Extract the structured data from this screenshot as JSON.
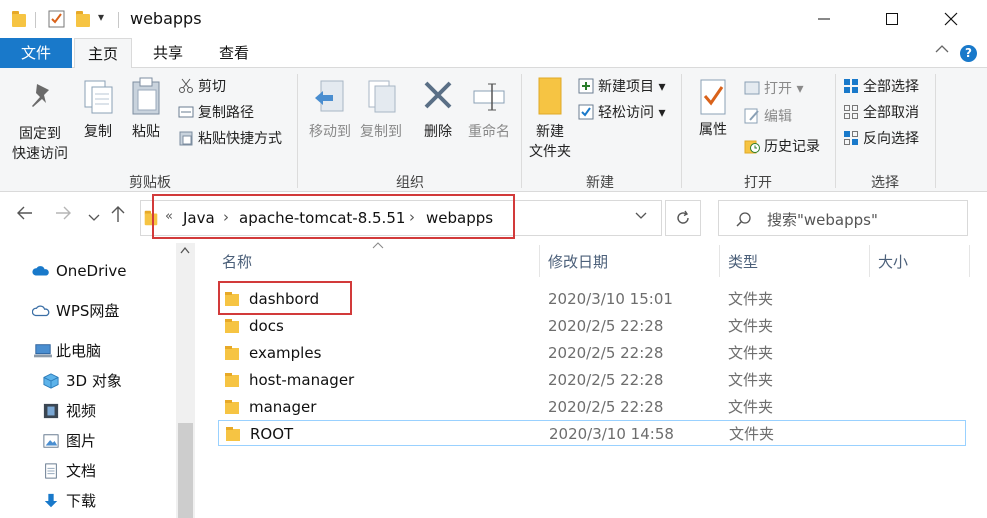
{
  "window": {
    "title": "webapps",
    "controls": [
      "minimize-icon",
      "maximize-icon",
      "close-icon"
    ]
  },
  "quick_access": {
    "customize_glyph": "▾"
  },
  "tabs": [
    {
      "label": "文件"
    },
    {
      "label": "主页"
    },
    {
      "label": "共享"
    },
    {
      "label": "查看"
    }
  ],
  "ribbon": {
    "clipboard": {
      "group_label": "剪贴板",
      "pin_label_line1": "固定到",
      "pin_label_line2": "快速访问",
      "copy_label": "复制",
      "paste_label": "粘贴",
      "cut_label": "剪切",
      "copy_path_label": "复制路径",
      "paste_shortcut_label": "粘贴快捷方式"
    },
    "organize": {
      "group_label": "组织",
      "move_to_label": "移动到",
      "copy_to_label": "复制到",
      "delete_label": "删除",
      "rename_label": "重命名"
    },
    "new": {
      "group_label": "新建",
      "new_folder_line1": "新建",
      "new_folder_line2": "文件夹",
      "new_item_label": "新建项目",
      "easy_access_label": "轻松访问"
    },
    "open": {
      "group_label": "打开",
      "properties_label": "属性",
      "open_label": "打开",
      "edit_label": "编辑",
      "history_label": "历史记录"
    },
    "select": {
      "group_label": "选择",
      "select_all_label": "全部选择",
      "select_none_label": "全部取消",
      "invert_label": "反向选择"
    }
  },
  "address": {
    "overflow": "«",
    "crumbs": [
      "Java",
      "apache-tomcat-8.5.51",
      "webapps"
    ],
    "search_placeholder": "搜索\"webapps\""
  },
  "sidebar": {
    "items": [
      {
        "label": "OneDrive",
        "icon": "cloud-icon"
      },
      {
        "label": "WPS网盘",
        "icon": "cloud-outline-icon"
      },
      {
        "label": "此电脑",
        "icon": "computer-icon"
      },
      {
        "label": "3D 对象",
        "icon": "cube-icon"
      },
      {
        "label": "视频",
        "icon": "film-icon"
      },
      {
        "label": "图片",
        "icon": "picture-icon"
      },
      {
        "label": "文档",
        "icon": "document-icon"
      },
      {
        "label": "下载",
        "icon": "download-icon"
      }
    ]
  },
  "columns": {
    "name": "名称",
    "date": "修改日期",
    "type": "类型",
    "size": "大小"
  },
  "files": [
    {
      "name": "dashbord",
      "date": "2020/3/10 15:01",
      "type": "文件夹"
    },
    {
      "name": "docs",
      "date": "2020/2/5 22:28",
      "type": "文件夹"
    },
    {
      "name": "examples",
      "date": "2020/2/5 22:28",
      "type": "文件夹"
    },
    {
      "name": "host-manager",
      "date": "2020/2/5 22:28",
      "type": "文件夹"
    },
    {
      "name": "manager",
      "date": "2020/2/5 22:28",
      "type": "文件夹"
    },
    {
      "name": "ROOT",
      "date": "2020/3/10 14:58",
      "type": "文件夹"
    }
  ],
  "colors": {
    "accent": "#1979ca",
    "highlight_box": "#d23a3a",
    "folder": "#f6c443",
    "selection_border": "#99d1ff"
  }
}
